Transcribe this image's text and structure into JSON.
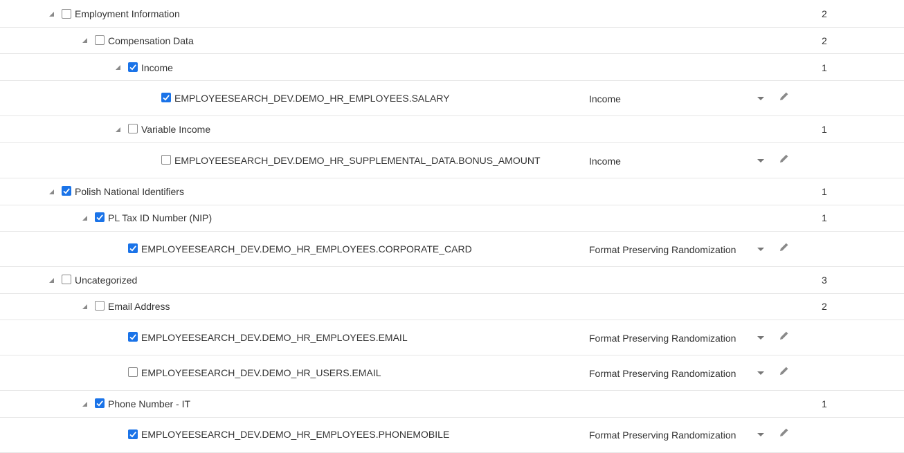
{
  "rows": [
    {
      "id": "r0",
      "type": "group",
      "level": 0,
      "label": "Employment Information",
      "count": "2",
      "checked": false
    },
    {
      "id": "r1",
      "type": "group",
      "level": 1,
      "label": "Compensation Data",
      "count": "2",
      "checked": false
    },
    {
      "id": "r2",
      "type": "group",
      "level": 2,
      "label": "Income",
      "count": "1",
      "checked": true
    },
    {
      "id": "r3",
      "type": "column",
      "label": "EMPLOYEESEARCH_DEV.DEMO_HR_EMPLOYEES.SALARY",
      "method": "Income",
      "checked": true
    },
    {
      "id": "r4",
      "type": "group",
      "level": 2,
      "label": "Variable Income",
      "count": "1",
      "checked": false
    },
    {
      "id": "r5",
      "type": "column",
      "label": "EMPLOYEESEARCH_DEV.DEMO_HR_SUPPLEMENTAL_DATA.BONUS_AMOUNT",
      "method": "Income",
      "checked": false
    },
    {
      "id": "r6",
      "type": "group",
      "level": 0,
      "label": "Polish National Identifiers",
      "count": "1",
      "checked": true
    },
    {
      "id": "r7",
      "type": "group",
      "level": 1,
      "label": "PL Tax ID Number (NIP)",
      "count": "1",
      "checked": true
    },
    {
      "id": "r8",
      "type": "column",
      "label": "EMPLOYEESEARCH_DEV.DEMO_HR_EMPLOYEES.CORPORATE_CARD",
      "method": "Format Preserving Randomization",
      "checked": true
    },
    {
      "id": "r9",
      "type": "group",
      "level": 0,
      "label": "Uncategorized",
      "count": "3",
      "checked": false
    },
    {
      "id": "r10",
      "type": "group",
      "level": 1,
      "label": "Email Address",
      "count": "2",
      "checked": false
    },
    {
      "id": "r11",
      "type": "column",
      "label": "EMPLOYEESEARCH_DEV.DEMO_HR_EMPLOYEES.EMAIL",
      "method": "Format Preserving Randomization",
      "checked": true
    },
    {
      "id": "r12",
      "type": "column",
      "label": "EMPLOYEESEARCH_DEV.DEMO_HR_USERS.EMAIL",
      "method": "Format Preserving Randomization",
      "checked": false
    },
    {
      "id": "r13",
      "type": "group",
      "level": 1,
      "label": "Phone Number - IT",
      "count": "1",
      "checked": true
    },
    {
      "id": "r14",
      "type": "column",
      "label": "EMPLOYEESEARCH_DEV.DEMO_HR_EMPLOYEES.PHONEMOBILE",
      "method": "Format Preserving Randomization",
      "checked": true
    }
  ],
  "icons": {
    "expand": "triangle-expanded-icon",
    "edit": "pencil-icon",
    "dropdown": "chevron-down-icon"
  },
  "colors": {
    "checked": "#1a73e8",
    "border": "#e6e6e6"
  }
}
